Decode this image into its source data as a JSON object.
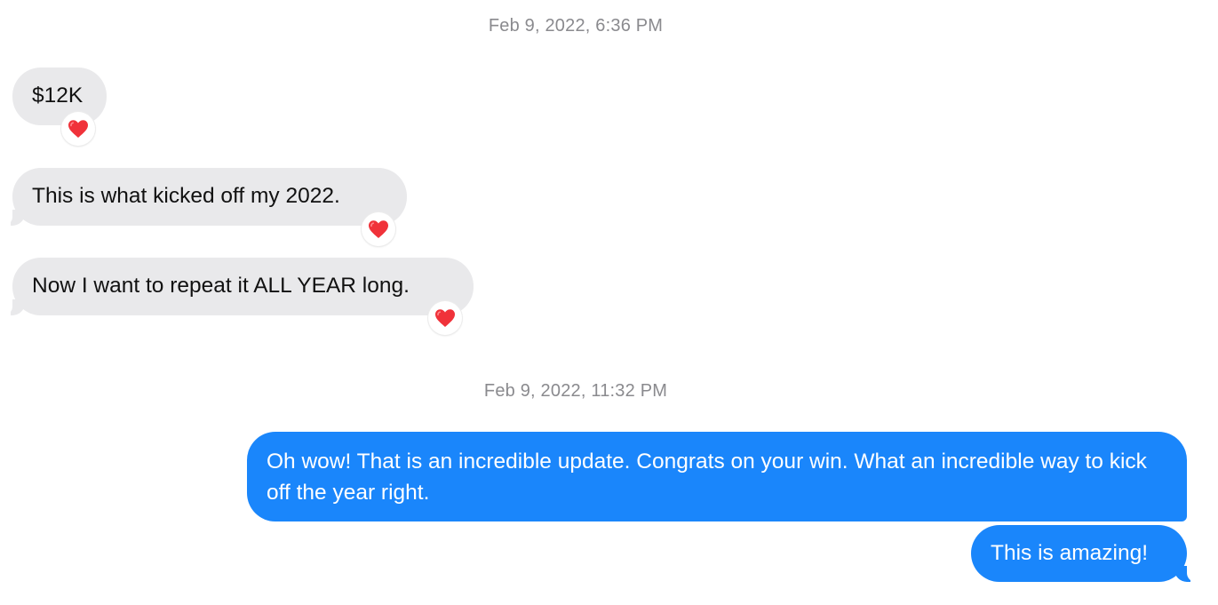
{
  "thread": {
    "groups": [
      {
        "timestamp": "Feb 9, 2022, 6:36 PM",
        "messages": [
          {
            "text": "$12K",
            "direction": "incoming",
            "reaction": "heart-icon"
          },
          {
            "text": "This is what kicked off my 2022.",
            "direction": "incoming",
            "reaction": "heart-icon"
          },
          {
            "text": "Now I want to repeat it ALL YEAR long.",
            "direction": "incoming",
            "reaction": "heart-icon"
          }
        ]
      },
      {
        "timestamp": "Feb 9, 2022, 11:32 PM",
        "messages": [
          {
            "text": "Oh wow!  That is an incredible update.  Congrats on your win.  What an incredible way to kick off the year right.",
            "direction": "outgoing"
          },
          {
            "text": "This is amazing!",
            "direction": "outgoing"
          }
        ]
      }
    ]
  },
  "colors": {
    "incoming_bubble": "#e9e9eb",
    "outgoing_bubble": "#1a86fb",
    "timestamp_text": "#8a8a8e",
    "heart": "#f0323a"
  }
}
